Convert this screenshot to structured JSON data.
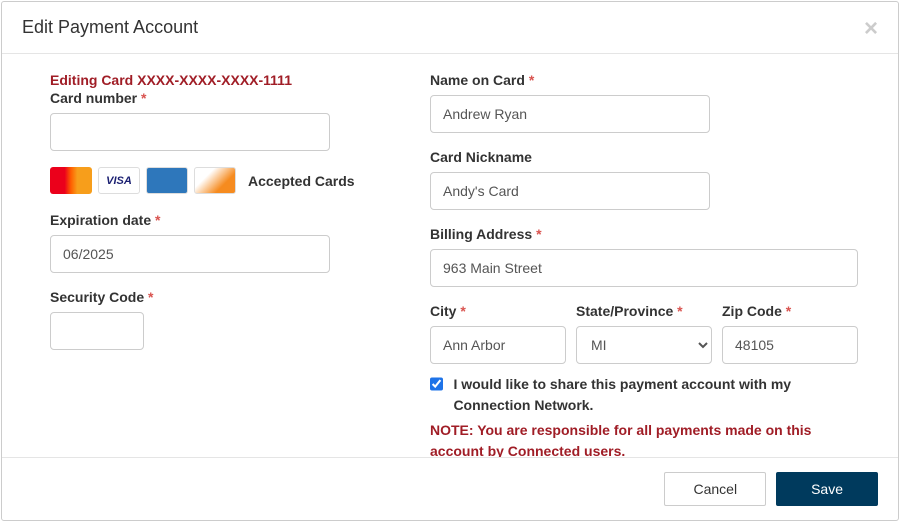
{
  "modal": {
    "title": "Edit Payment Account",
    "editing_subtitle": "Editing Card XXXX-XXXX-XXXX-1111"
  },
  "labels": {
    "card_number": "Card number",
    "accepted_cards": "Accepted Cards",
    "expiration_date": "Expiration date",
    "security_code": "Security Code",
    "name_on_card": "Name on Card",
    "card_nickname": "Card Nickname",
    "billing_address": "Billing Address",
    "city": "City",
    "state": "State/Province",
    "zip": "Zip Code",
    "share_checkbox": "I would like to share this payment account with my Connection Network.",
    "note": "NOTE: You are responsible for all payments made on this account by Connected users."
  },
  "values": {
    "card_number": "",
    "expiration_date": "06/2025",
    "security_code": "",
    "name_on_card": "Andrew Ryan",
    "card_nickname": "Andy's Card",
    "billing_address": "963 Main Street",
    "city": "Ann Arbor",
    "state": "MI",
    "zip": "48105",
    "share_checked": true
  },
  "buttons": {
    "cancel": "Cancel",
    "save": "Save"
  },
  "card_brands": {
    "mastercard": "mastercard",
    "visa": "VISA",
    "amex": "AMEX",
    "discover": "DISCOVER"
  },
  "required_marker": "*"
}
